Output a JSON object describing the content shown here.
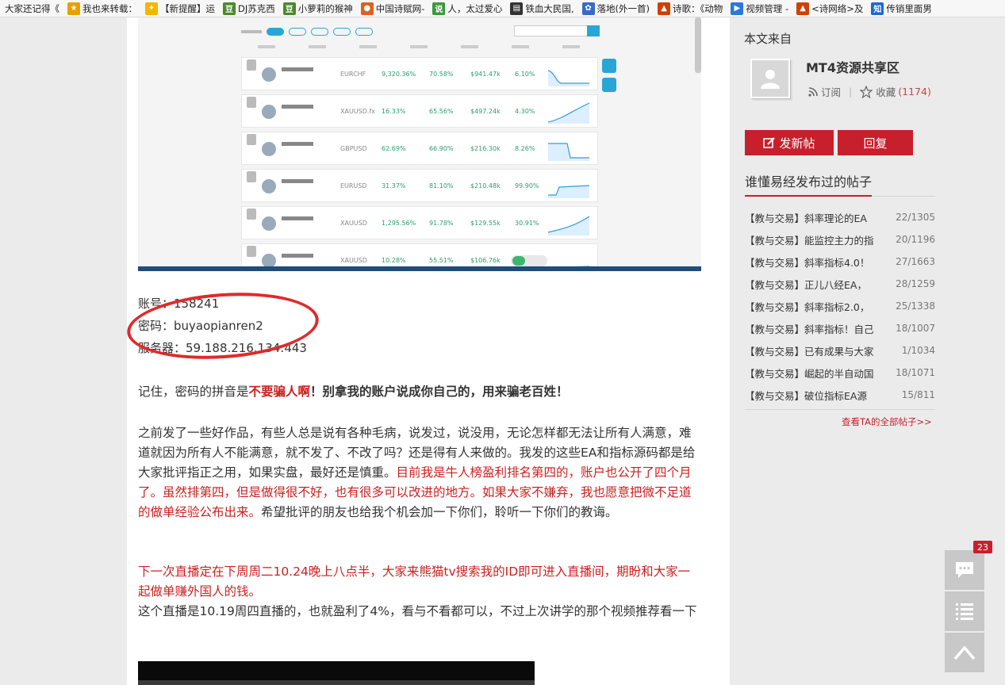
{
  "bookmarks": [
    {
      "label": "大家还记得《",
      "icon_color": "",
      "glyph": ""
    },
    {
      "label": "我也来转载：",
      "icon_color": "#e8a000",
      "glyph": "★"
    },
    {
      "label": "【新提醒】运",
      "icon_color": "#f2b600",
      "glyph": "✦"
    },
    {
      "label": "DJ苏克西",
      "icon_color": "#4a8a2a",
      "glyph": "豆"
    },
    {
      "label": "小萝莉的猴神",
      "icon_color": "#4a8a2a",
      "glyph": "豆"
    },
    {
      "label": "中国诗赋网-",
      "icon_color": "#e06020",
      "glyph": "●"
    },
    {
      "label": "人，太过爱心",
      "icon_color": "#3a9a3a",
      "glyph": "说"
    },
    {
      "label": "铁血大民国,",
      "icon_color": "#333333",
      "glyph": "▤"
    },
    {
      "label": "落地(外一首)",
      "icon_color": "#3a6ac8",
      "glyph": "✿"
    },
    {
      "label": "诗歌：《动物",
      "icon_color": "#d04000",
      "glyph": "▲"
    },
    {
      "label": "视频管理 -",
      "icon_color": "#2a7ad8",
      "glyph": "▶"
    },
    {
      "label": "<诗网络>及",
      "icon_color": "#d04000",
      "glyph": "▲"
    },
    {
      "label": "传销里面男",
      "icon_color": "#1a6ad8",
      "glyph": "知"
    }
  ],
  "account": {
    "account_line": "账号：158241",
    "password_line": "密码：buyaopianren2",
    "server_line": "服务器：59.188.216.134:443"
  },
  "paragraphs": {
    "p1_a": "记住，密码的拼音是",
    "p1_b": "不要骗人啊",
    "p1_c": "！别拿我的账户说成你自己的，用来骗老百姓！",
    "p2_a": "之前发了一些好作品，有些人总是说有各种毛病，说发过，说没用，无论怎样都无法让所有人满意，难道就因为所有人不能满意，就不发了、不改了吗？还是得有人来做的。我发的这些EA和指标源码都是给大家批评指正之用，如果实盘，最好还是慎重。",
    "p2_b": "目前我是牛人榜盈利排名第四的，账户也公开了四个月了。虽然排第四，但是做得很不好，也有很多可以改进的地方。如果大家不嫌弃，我也愿意把微不足道的做单经验公布出来。",
    "p2_c": "希望批评的朋友也给我个机会加一下你们，聆听一下你们的教诲。",
    "p3_a": "下一次直播定在下周周二10.24晚上八点半，大家来熊猫tv搜索我的ID即可进入直播间，期盼和大家一起做单赚外国人的钱。",
    "p3_b": "这个直播是10.19周四直播的，也就盈利了4%，看与不看都可以，不过上次讲学的那个视频推荐看一下"
  },
  "screenshot_table": {
    "rows": [
      {
        "symbol": "EURCHF",
        "profit": "9,320.36%",
        "winrate": "70.58%",
        "balance": "$941.47k",
        "drawdown": "6.10%"
      },
      {
        "symbol": "XAUUSD.fx",
        "profit": "16.33%",
        "winrate": "65.56%",
        "balance": "$497.24k",
        "drawdown": "4.30%"
      },
      {
        "symbol": "GBPUSD",
        "profit": "62.69%",
        "winrate": "66.90%",
        "balance": "$216.30k",
        "drawdown": "8.26%"
      },
      {
        "symbol": "EURUSD",
        "profit": "31.37%",
        "winrate": "81.10%",
        "balance": "$210.48k",
        "drawdown": "99.90%"
      },
      {
        "symbol": "XAUUSD",
        "profit": "1,295.56%",
        "winrate": "91.78%",
        "balance": "$129.55k",
        "drawdown": "30.91%"
      },
      {
        "symbol": "XAUUSD",
        "profit": "10.28%",
        "winrate": "55.51%",
        "balance": "$106.76k",
        "drawdown": ""
      }
    ]
  },
  "sidebar": {
    "source_title": "本文来自",
    "group_name": "MT4资源共享区",
    "subscribe": "订阅",
    "favorite": "收藏",
    "favorite_count": "(1174)",
    "new_post_btn": "发新帖",
    "reply_btn": "回复",
    "posts_title": "谁懂易经发布过的帖子",
    "posts": [
      {
        "title": "【教与交易】斜率理论的EA",
        "count": "22/1305"
      },
      {
        "title": "【教与交易】能监控主力的指",
        "count": "20/1196"
      },
      {
        "title": "【教与交易】斜率指标4.0！",
        "count": "27/1663"
      },
      {
        "title": "【教与交易】正儿八经EA，",
        "count": "28/1259"
      },
      {
        "title": "【教与交易】斜率指标2.0，",
        "count": "25/1338"
      },
      {
        "title": "【教与交易】斜率指标！自己",
        "count": "18/1007"
      },
      {
        "title": "【教与交易】已有成果与大家",
        "count": "1/1034"
      },
      {
        "title": "【教与交易】崛起的半自动国",
        "count": "18/1071"
      },
      {
        "title": "【教与交易】破位指标EA源",
        "count": "15/811"
      }
    ],
    "all_posts_link": "查看TA的全部帖子>>"
  },
  "floating": {
    "comment_count": "23",
    "icons": [
      "comment-icon",
      "list-icon",
      "back-to-top-icon"
    ]
  }
}
